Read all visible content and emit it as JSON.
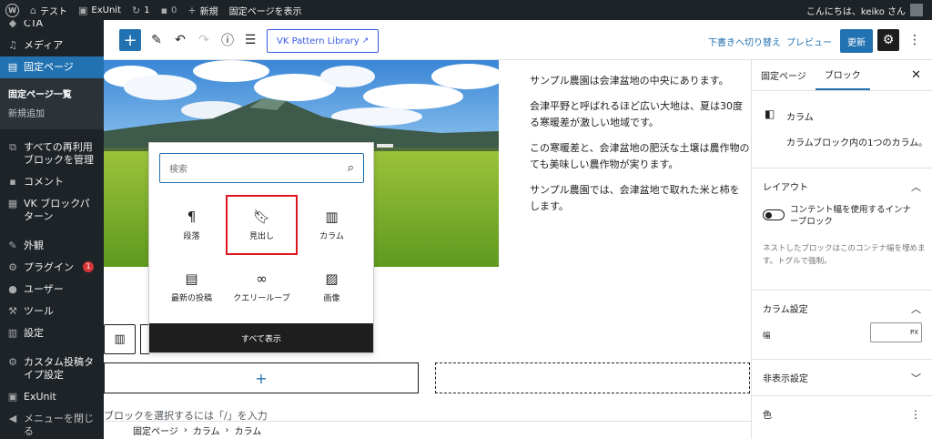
{
  "admin_bar": {
    "site_name": "テスト",
    "exunit": "ExUnit",
    "updates_count": "1",
    "comments_count": "0",
    "new_label": "新規",
    "view_page": "固定ページを表示",
    "greeting": "こんにちは、keiko さん"
  },
  "sidebar": {
    "items": [
      {
        "label": "CTA",
        "icon": "cta-icon"
      },
      {
        "label": "メディア",
        "icon": "media-icon"
      },
      {
        "label": "固定ページ",
        "icon": "pages-icon"
      },
      {
        "label": "すべての再利用ブロックを管理",
        "icon": "reusable-icon"
      },
      {
        "label": "コメント",
        "icon": "comments-icon"
      },
      {
        "label": "VK ブロックパターン",
        "icon": "patterns-icon"
      },
      {
        "label": "外観",
        "icon": "appearance-icon"
      },
      {
        "label": "プラグイン",
        "icon": "plugins-icon",
        "badge": "1"
      },
      {
        "label": "ユーザー",
        "icon": "users-icon"
      },
      {
        "label": "ツール",
        "icon": "tools-icon"
      },
      {
        "label": "設定",
        "icon": "settings-icon"
      },
      {
        "label": "カスタム投稿タイプ設定",
        "icon": "cpt-icon"
      },
      {
        "label": "ExUnit",
        "icon": "exunit-icon"
      },
      {
        "label": "メニューを閉じる",
        "icon": "collapse-icon"
      }
    ],
    "submenu": [
      "固定ページ一覧",
      "新規追加"
    ]
  },
  "toolbar": {
    "vk_pattern": "VK Pattern Library",
    "switch_draft": "下書きへ切り替え",
    "preview": "プレビュー",
    "update": "更新"
  },
  "content": {
    "paragraphs": [
      "サンプル農園は会津盆地の中央にあります。",
      "会津平野と呼ばれるほど広い大地は、夏は30度",
      "る寒暖差が激しい地域です。",
      "この寒暖差と、会津盆地の肥沃な土壌は農作物の",
      "ても美味しい農作物が実ります。",
      "サンプル農園では、会津盆地で取れた米と柿を",
      "します。"
    ],
    "hint": "ブロックを選択するには「/」を入力"
  },
  "inserter": {
    "search_placeholder": "検索",
    "items": [
      {
        "label": "段落",
        "icon": "paragraph-icon"
      },
      {
        "label": "見出し",
        "icon": "heading-icon"
      },
      {
        "label": "カラム",
        "icon": "columns-icon"
      },
      {
        "label": "最新の投稿",
        "icon": "latest-posts-icon"
      },
      {
        "label": "クエリーループ",
        "icon": "query-loop-icon"
      },
      {
        "label": "画像",
        "icon": "image-icon"
      }
    ],
    "show_all": "すべて表示"
  },
  "breadcrumb": [
    "固定ページ",
    "カラム",
    "カラム"
  ],
  "settings": {
    "tabs": [
      "固定ページ",
      "ブロック"
    ],
    "block_name": "カラム",
    "block_desc": "カラムブロック内の1つのカラム。",
    "layout_title": "レイアウト",
    "toggle_label": "コンテント幅を使用するインナーブロック",
    "toggle_help": "ネストしたブロックはこのコンテナ幅を埋めます。トグルで強制。",
    "column_settings": "カラム設定",
    "width_label": "幅",
    "width_unit": "PX",
    "hidden_settings": "非表示設定",
    "color": "色"
  },
  "colors": {
    "accent": "#2271b1",
    "admin_bg": "#1d2327",
    "highlight_border": "#e0141b"
  }
}
